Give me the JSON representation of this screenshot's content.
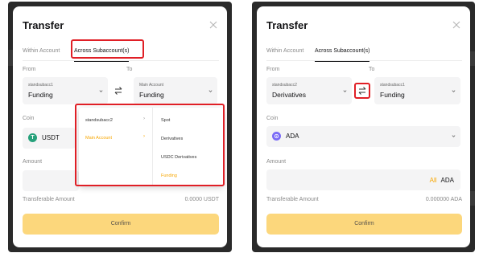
{
  "left_panel": {
    "title": "Transfer",
    "tabs": {
      "within": "Within Account",
      "across": "Across Subaccount(s)"
    },
    "from_label": "From",
    "to_label": "To",
    "from_account": "standsubacc1",
    "from_type": "Funding",
    "to_account": "Main Account",
    "to_type": "Funding",
    "coin_label": "Coin",
    "coin": "USDT",
    "coin_icon_letter": "T",
    "amount_label": "Amount",
    "transferable_label": "Transferable Amount",
    "transferable_value": "0.0000 USDT",
    "confirm": "Confirm",
    "dropdown": {
      "accounts": [
        "standsubacc2",
        "Main Account"
      ],
      "types": [
        "Spot",
        "Derivatives",
        "USDC Derivatives",
        "Funding"
      ]
    }
  },
  "right_panel": {
    "title": "Transfer",
    "tabs": {
      "within": "Within Account",
      "across": "Across Subaccount(s)"
    },
    "from_label": "From",
    "to_label": "To",
    "from_account": "standsubacc2",
    "from_type": "Derivatives",
    "to_account": "standsubacc1",
    "to_type": "Funding",
    "coin_label": "Coin",
    "coin": "ADA",
    "amount_label": "Amount",
    "amount_all": "All",
    "amount_currency": "ADA",
    "transferable_label": "Transferable Amount",
    "transferable_value": "0.000000 ADA",
    "confirm": "Confirm"
  },
  "colors": {
    "accent": "#f7a600",
    "confirm_bg": "#fcd77c",
    "highlight_box": "#e01f26",
    "usdt": "#26a17b",
    "ada": "#7b6cf6"
  }
}
